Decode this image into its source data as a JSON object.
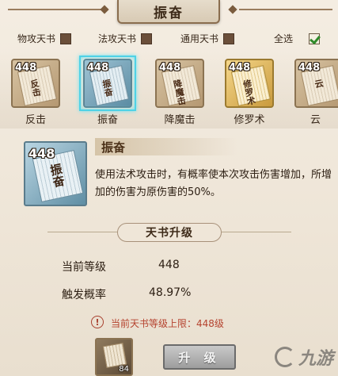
{
  "title": "振奋",
  "filters": [
    {
      "label": "物攻天书",
      "checked": false
    },
    {
      "label": "法攻天书",
      "checked": false
    },
    {
      "label": "通用天书",
      "checked": false
    },
    {
      "label": "全选",
      "checked": true
    }
  ],
  "books": [
    {
      "name": "反击",
      "level": "448",
      "glyph": "反击",
      "style": "tan",
      "selected": false
    },
    {
      "name": "振奋",
      "level": "448",
      "glyph": "振奋",
      "style": "blue",
      "selected": true
    },
    {
      "name": "降魔击",
      "level": "448",
      "glyph": "降魔击",
      "style": "tan",
      "selected": false
    },
    {
      "name": "修罗术",
      "level": "448",
      "glyph": "修罗术",
      "style": "gold",
      "selected": false
    },
    {
      "name": "云",
      "level": "448",
      "glyph": "云",
      "style": "tan",
      "selected": false
    }
  ],
  "detail": {
    "level": "448",
    "glyph": "振奋",
    "name": "振奋",
    "description": "使用法术攻击时，有概率使本次攻击伤害增加，所增加的伤害为原伤害的50%。"
  },
  "upgrade_section": {
    "heading": "天书升级",
    "stats": [
      {
        "label": "当前等级",
        "value": "448"
      },
      {
        "label": "触发概率",
        "value": "48.97%"
      }
    ],
    "warning_icon": "!",
    "warning": "当前天书等级上限：448级",
    "item_count": "84",
    "button_label": "升 级"
  },
  "watermark": "九游",
  "icons": {
    "warning": "warning-icon",
    "scroll": "scroll-icon",
    "checkbox": "checkbox-icon"
  },
  "colors": {
    "selected_frame": "#4fd2e6",
    "warning_text": "#b5432f",
    "check": "#2f8a2a"
  }
}
